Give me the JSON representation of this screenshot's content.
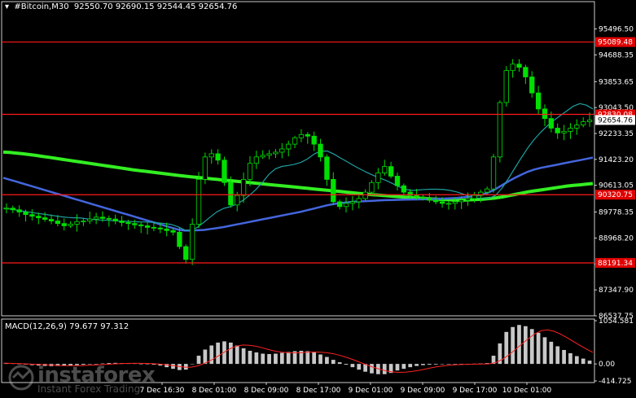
{
  "header": {
    "symbol_text": "▾  #Bitcoin,M30  92550.70 92690.15 92544.45 92654.76",
    "macd_text": "MACD(12,26,9) 79.677 97.312"
  },
  "watermark": {
    "brand": "instaforex",
    "tagline": "Instant Forex Trading"
  },
  "colors": {
    "background": "#000000",
    "candle": "#00e000",
    "ma_slow": "#33ee22",
    "ma_mid": "#4466dd",
    "ma_fast": "#20a0a0",
    "level_line": "#ff1a1a",
    "level_label_bg": "#e00000",
    "price_tag_bg": "#ffffff",
    "macd_hist": "#c8c8c8",
    "macd_signal": "#ff2222"
  },
  "chart_data": [
    {
      "type": "candlestick",
      "title": "#Bitcoin,M30",
      "ylim": [
        86537.75,
        96200
      ],
      "y_ticks": [
        "95496.50",
        "94688.35",
        "93853.65",
        "93043.50",
        "92233.35",
        "91423.20",
        "90613.05",
        "89778.35",
        "88968.20",
        "88158.05",
        "87347.90",
        "86537.75"
      ],
      "x_ticks": [
        "7 Dec 16:30",
        "8 Dec 01:00",
        "8 Dec 09:00",
        "8 Dec 17:00",
        "9 Dec 01:00",
        "9 Dec 09:00",
        "9 Dec 17:00",
        "10 Dec 01:00"
      ],
      "levels": [
        {
          "label": "95089.48",
          "value": 95089.48
        },
        {
          "label": "92830.08",
          "value": 92830.08
        },
        {
          "label": "90320.75",
          "value": 90320.75
        },
        {
          "label": "88191.34",
          "value": 88191.34
        }
      ],
      "current_price": {
        "label": "92654.76",
        "value": 92654.76
      },
      "ohlc_last": {
        "open": 92550.7,
        "high": 92690.15,
        "low": 92544.45,
        "close": 92654.76
      },
      "close_series": [
        89900,
        89850,
        89780,
        89700,
        89650,
        89600,
        89550,
        89500,
        89420,
        89350,
        89400,
        89480,
        89500,
        89560,
        89620,
        89580,
        89560,
        89500,
        89450,
        89420,
        89380,
        89350,
        89300,
        89280,
        89250,
        89200,
        89150,
        88700,
        88300,
        89400,
        90800,
        91500,
        91600,
        91400,
        90700,
        90000,
        90300,
        90800,
        91300,
        91500,
        91550,
        91600,
        91650,
        91750,
        91900,
        92100,
        92200,
        92150,
        91900,
        91500,
        90800,
        90100,
        89950,
        90050,
        90100,
        90200,
        90400,
        90700,
        91000,
        91200,
        90900,
        90600,
        90400,
        90300,
        90250,
        90200,
        90150,
        90100,
        90050,
        90050,
        90100,
        90150,
        90200,
        90300,
        90400,
        90500,
        91500,
        93200,
        94200,
        94400,
        94300,
        94000,
        93500,
        93000,
        92700,
        92400,
        92250,
        92300,
        92400,
        92500,
        92600,
        92654.76
      ],
      "ma_slow": [
        91650,
        91640,
        91620,
        91600,
        91575,
        91550,
        91520,
        91490,
        91460,
        91430,
        91400,
        91370,
        91340,
        91310,
        91280,
        91250,
        91220,
        91190,
        91160,
        91130,
        91100,
        91075,
        91050,
        91025,
        91000,
        90975,
        90950,
        90925,
        90900,
        90880,
        90860,
        90840,
        90820,
        90800,
        90780,
        90760,
        90740,
        90720,
        90700,
        90680,
        90660,
        90640,
        90620,
        90600,
        90580,
        90560,
        90540,
        90520,
        90500,
        90480,
        90460,
        90440,
        90420,
        90400,
        90380,
        90360,
        90340,
        90320,
        90305,
        90290,
        90275,
        90260,
        90245,
        90230,
        90215,
        90200,
        90190,
        90180,
        90170,
        90160,
        90150,
        90150,
        90160,
        90170,
        90180,
        90200,
        90220,
        90250,
        90290,
        90330,
        90370,
        90410,
        90440,
        90470,
        90500,
        90530,
        90560,
        90590,
        90610,
        90630,
        90650,
        90670
      ],
      "ma_mid": [
        90850,
        90790,
        90730,
        90670,
        90610,
        90550,
        90490,
        90430,
        90370,
        90310,
        90250,
        90190,
        90130,
        90070,
        90010,
        89950,
        89890,
        89830,
        89770,
        89710,
        89650,
        89590,
        89530,
        89470,
        89410,
        89350,
        89290,
        89230,
        89200,
        89200,
        89210,
        89220,
        89250,
        89280,
        89310,
        89350,
        89390,
        89430,
        89470,
        89510,
        89550,
        89590,
        89630,
        89670,
        89710,
        89750,
        89790,
        89840,
        89890,
        89940,
        89990,
        90030,
        90060,
        90080,
        90100,
        90110,
        90120,
        90130,
        90140,
        90150,
        90155,
        90160,
        90165,
        90170,
        90175,
        90180,
        90185,
        90190,
        90200,
        90210,
        90220,
        90240,
        90260,
        90290,
        90330,
        90400,
        90500,
        90620,
        90740,
        90850,
        90950,
        91040,
        91110,
        91160,
        91200,
        91240,
        91280,
        91320,
        91360,
        91400,
        91440,
        91480
      ]
    },
    {
      "type": "macd",
      "title": "MACD(12,26,9)",
      "macd": 79.677,
      "signal": 97.312,
      "ylim": [
        -414.725,
        1054.581
      ],
      "y_ticks": [
        "1054.581",
        "0.00",
        "-414.725"
      ],
      "histogram": [
        20,
        10,
        0,
        -15,
        -30,
        -40,
        -50,
        -55,
        -50,
        -45,
        -40,
        -30,
        -20,
        -10,
        0,
        10,
        20,
        25,
        20,
        15,
        10,
        0,
        -10,
        -20,
        -40,
        -80,
        -120,
        -150,
        -140,
        0,
        200,
        350,
        450,
        520,
        550,
        520,
        450,
        380,
        320,
        280,
        250,
        240,
        250,
        270,
        290,
        310,
        320,
        310,
        280,
        230,
        170,
        100,
        40,
        -20,
        -80,
        -140,
        -190,
        -230,
        -250,
        -250,
        -220,
        -160,
        -120,
        -80,
        -50,
        -30,
        -20,
        -15,
        -10,
        -8,
        -5,
        -3,
        0,
        5,
        10,
        20,
        200,
        500,
        780,
        900,
        950,
        920,
        850,
        760,
        650,
        540,
        430,
        340,
        260,
        190,
        130,
        80
      ]
    }
  ]
}
